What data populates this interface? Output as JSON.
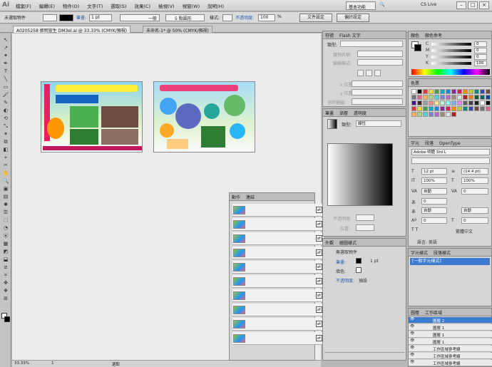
{
  "app": {
    "logo": "Ai"
  },
  "menubar": {
    "items": [
      "檔案(F)",
      "編輯(E)",
      "物件(O)",
      "文字(T)",
      "選取(S)",
      "效果(C)",
      "檢視(V)",
      "視窗(W)",
      "說明(H)"
    ],
    "workspace": "基本功能",
    "search": "",
    "cslive": "CS Live"
  },
  "control": {
    "selection": "未選取物件",
    "stroke_label": "筆畫:",
    "stroke_value": "1 pt",
    "line_label": "一般",
    "brush_label": "5 點圓形",
    "style_label": "樣式:",
    "opacity_label": "不透明度:",
    "opacity_value": "100",
    "opacity_unit": "%",
    "doc_setup": "文件設定",
    "prefs": "偏好設定"
  },
  "tabs": [
    {
      "label": "A0205258 敘明宣生 DM3el.ai @ 33.33% (CMYK/預視)",
      "active": true
    },
    {
      "label": "未命名-1* @ 50% (CMYK/預視)",
      "active": false
    }
  ],
  "canvas": {
    "zoom": "33.33%",
    "page": "1",
    "status": "選取"
  },
  "flash_panel": {
    "tabs": [
      "符號",
      "Flash 文字"
    ],
    "name_label": "類型:",
    "rows": [
      "實例名稱:",
      "編輯樣式:"
    ],
    "rows2": [
      "x 位置:",
      "y 位置:",
      "寬:",
      "高:"
    ],
    "anti_label": "消除鋸齒:"
  },
  "gradient_panel": {
    "tabs": [
      "筆畫",
      "漸層",
      "透明度"
    ],
    "type_label": "類型:",
    "type_value": "線性",
    "opacity_label": "不透明度:",
    "loc_label": "位置:"
  },
  "actions_panel": {
    "tabs": [
      "動作",
      "連結"
    ],
    "rows": 10
  },
  "appearance_panel": {
    "tabs": [
      "外觀",
      "繪圖樣式"
    ],
    "title": "無選取物件",
    "stroke": "筆畫:",
    "stroke_value": "1 pt",
    "fill": "填色:",
    "opacity": "不透明度:",
    "opacity_value": "預設"
  },
  "color_panel": {
    "tabs": [
      "顏色",
      "顏色參考"
    ],
    "channels": [
      "C",
      "M",
      "Y",
      "K"
    ],
    "values": [
      "0",
      "0",
      "0",
      "100"
    ],
    "unit": "%"
  },
  "swatch_panel": {
    "tabs": [
      "色票"
    ]
  },
  "char_panel": {
    "tabs": [
      "字元",
      "段落",
      "OpenType"
    ],
    "font": "Adobe 明體 Std L",
    "size": "12 pt",
    "leading": "(14.4 pt)",
    "auto": "自動",
    "zero": "0",
    "pct": "100%",
    "lang": "繁體中文",
    "lang_label": "語言:",
    "align_label": "對齊:",
    "align_value": "語言: 美語"
  },
  "charstyle_panel": {
    "tabs": [
      "字元樣式",
      "段落樣式"
    ],
    "item": "[一般字元樣式]"
  },
  "layers_panel": {
    "tabs": [
      "圖層",
      "工作區域"
    ],
    "layers": [
      "圖層 2",
      "圖層 1",
      "圖層 1",
      "圖層 1",
      "工作區域參考線",
      "工作區域參考線",
      "工作區域參考線"
    ]
  },
  "colors": {
    "accent": "#3d7bd0",
    "menubar": "#dadada"
  }
}
